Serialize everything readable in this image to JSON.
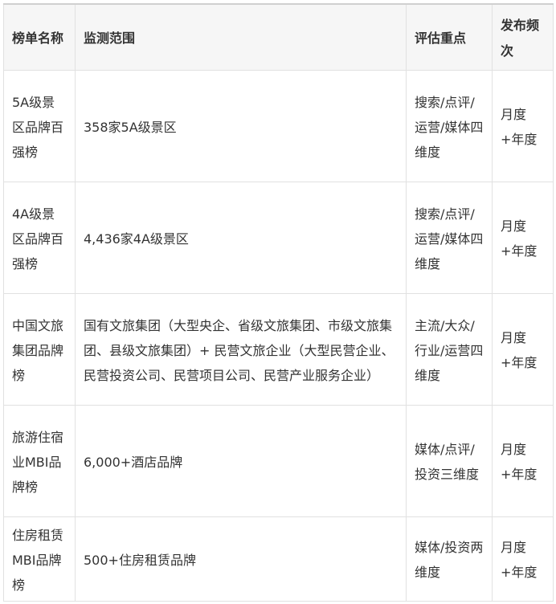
{
  "headers": {
    "name": "榜单名称",
    "scope": "监测范围",
    "focus": "评估重点",
    "frequency": "发布频次"
  },
  "rows": [
    {
      "name": "5A级景区品牌百强榜",
      "scope": "358家5A级景区",
      "focus": "搜索/点评/运营/媒体四维度",
      "frequency": "月度+年度"
    },
    {
      "name": "4A级景区品牌百强榜",
      "scope": "4,436家4A级景区",
      "focus": "搜索/点评/运营/媒体四维度",
      "frequency": "月度+年度"
    },
    {
      "name": "中国文旅集团品牌榜",
      "scope": "国有文旅集团（大型央企、省级文旅集团、市级文旅集团、县级文旅集团）+ 民营文旅企业（大型民营企业、民营投资公司、民营项目公司、民营产业服务企业）",
      "focus": "主流/大众/行业/运营四维度",
      "frequency": "月度+年度"
    },
    {
      "name": "旅游住宿业MBI品牌榜",
      "scope": "6,000+酒店品牌",
      "focus": "媒体/点评/投资三维度",
      "frequency": "月度+年度"
    },
    {
      "name": "住房租赁MBI品牌榜",
      "scope": "500+住房租赁品牌",
      "focus": "媒体/投资两维度",
      "frequency": "月度+年度"
    }
  ]
}
